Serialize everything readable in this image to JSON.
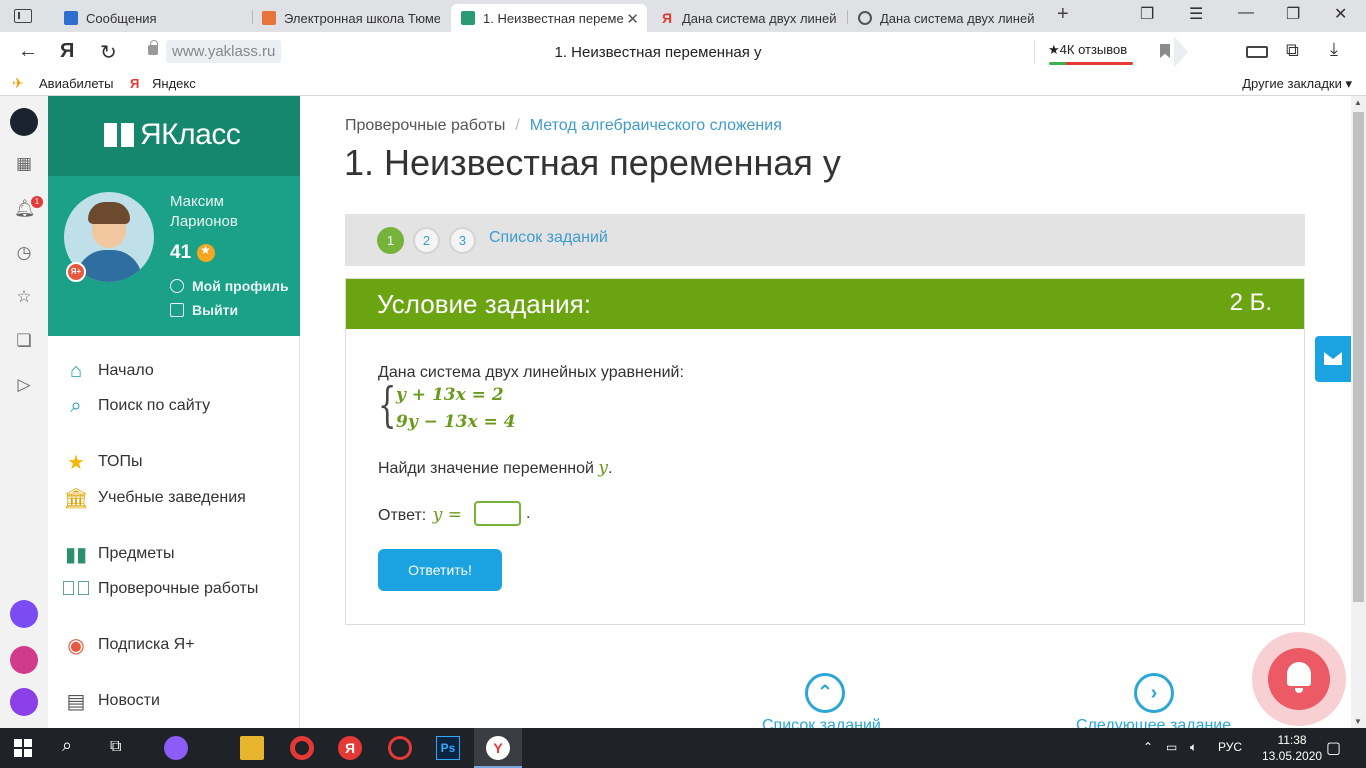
{
  "browser": {
    "tabs": [
      {
        "label": "Сообщения",
        "active": false
      },
      {
        "label": "Электронная школа Тюме",
        "active": false
      },
      {
        "label": "1. Неизвестная переме",
        "active": true
      },
      {
        "label": "Дана система двух линейн",
        "active": false
      },
      {
        "label": "Дана система двух линейн",
        "active": false
      }
    ],
    "domain": "www.yaklass.ru",
    "page_title": "1. Неизвестная переменная y",
    "reviews": "★4К отзывов",
    "bookmarks": [
      "Авиабилеты",
      "Яндекс"
    ],
    "other_bookmarks": "Другие закладки ▾"
  },
  "sidepanel": {
    "notification_count": "1"
  },
  "sidebar": {
    "logo": "ЯКласс",
    "user": {
      "name": "Максим Ларионов",
      "points": "41",
      "profile_link": "Мой профиль",
      "logout_link": "Выйти",
      "badge": "Я+"
    },
    "menu": [
      {
        "label": "Начало",
        "icon": "home-icon"
      },
      {
        "label": "Поиск по сайту",
        "icon": "search-icon"
      },
      {
        "label": "ТОПы",
        "icon": "star-icon"
      },
      {
        "label": "Учебные заведения",
        "icon": "institution-icon"
      },
      {
        "label": "Предметы",
        "icon": "subjects-icon"
      },
      {
        "label": "Проверочные работы",
        "icon": "check-icon"
      },
      {
        "label": "Подписка Я+",
        "icon": "subscription-icon"
      },
      {
        "label": "Новости",
        "icon": "news-icon"
      }
    ]
  },
  "main": {
    "breadcrumb": [
      "Проверочные работы",
      "Метод алгебраического сложения"
    ],
    "title": "1. Неизвестная переменная y",
    "steps": [
      "1",
      "2",
      "3"
    ],
    "current_step": "1",
    "task_list_link": "Список заданий",
    "card": {
      "heading": "Условие задания:",
      "points": "2 Б.",
      "intro": "Дана система двух линейных уравнений:",
      "equations": [
        "y + 13x = 2",
        "9y − 13x = 4"
      ],
      "question": "Найди значение переменной",
      "question_var": "y",
      "answer_label": "Ответ:",
      "answer_var": "y =",
      "answer_value": "",
      "submit": "Ответить!"
    },
    "bottom_nav": {
      "list_label": "Список заданий",
      "next_label": "Следующее задание"
    }
  },
  "taskbar": {
    "language": "РУС",
    "time": "11:38",
    "date": "13.05.2020"
  },
  "colors": {
    "brand_green": "#15876c",
    "user_green": "#1aa187",
    "task_header": "#6aa511",
    "link_blue": "#3d9bcf",
    "button_blue": "#1aa3e0"
  }
}
